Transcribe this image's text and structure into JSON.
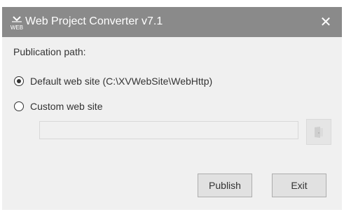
{
  "window": {
    "title": "Web Project Converter v7.1",
    "close_glyph": "✕",
    "icon": "web-app-icon",
    "icon_caption": "WEB"
  },
  "form": {
    "publication_path_label": "Publication path:",
    "options": [
      {
        "label": "Default web site (C:\\XVWebSite\\WebHttp)",
        "checked": true
      },
      {
        "label": "Custom web site",
        "checked": false
      }
    ],
    "custom_path_value": "",
    "browse_icon": "folder-icon"
  },
  "buttons": {
    "publish": "Publish",
    "exit": "Exit"
  },
  "colors": {
    "titlebar": "#8a8a8a",
    "body": "#f0f0f0"
  }
}
